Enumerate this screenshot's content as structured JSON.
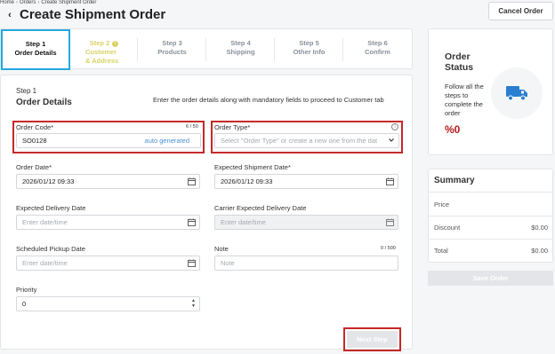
{
  "breadcrumb": [
    "Home",
    "Orders",
    "Create Shipment Order"
  ],
  "page_title": "Create Shipment Order",
  "cancel_label": "Cancel Order",
  "steps": [
    {
      "n": "Step 1",
      "label": "Order Details",
      "state": "active"
    },
    {
      "n": "Step 2",
      "label": "Customer & Address",
      "state": "warning"
    },
    {
      "n": "Step 3",
      "label": "Products",
      "state": "pending"
    },
    {
      "n": "Step 4",
      "label": "Shipping",
      "state": "pending"
    },
    {
      "n": "Step 5",
      "label": "Other Info",
      "state": "pending"
    },
    {
      "n": "Step 6",
      "label": "Confirm",
      "state": "pending"
    }
  ],
  "section": {
    "step": "Step 1",
    "title": "Order Details",
    "note": "Enter the order details along with mandatory fields to proceed to Customer tab"
  },
  "fields": {
    "order_code": {
      "label": "Order Code*",
      "counter": "6 / 50",
      "value": "SO0128",
      "hint": "auto generated"
    },
    "order_type": {
      "label": "Order Type*",
      "placeholder": "Select \"Order Type\" or create a new one from the dat"
    },
    "order_date": {
      "label": "Order Date*",
      "value": "2026/01/12 09:33"
    },
    "expected_shipment_date": {
      "label": "Expected Shipment Date*",
      "value": "2026/01/12 09:33"
    },
    "expected_delivery_date": {
      "label": "Expected Delivery Date",
      "placeholder": "Enter date/time"
    },
    "carrier_expected_delivery_date": {
      "label": "Carrier Expected Delivery Date",
      "placeholder": "Enter date/time"
    },
    "scheduled_pickup_date": {
      "label": "Scheduled Pickup Date",
      "placeholder": "Enter date/time"
    },
    "note": {
      "label": "Note",
      "counter": "0 / 500",
      "placeholder": "Note"
    },
    "priority": {
      "label": "Priority",
      "value": "0"
    }
  },
  "next_label": "Next Step",
  "order_status": {
    "title": "Order Status",
    "subtitle": "Follow all the steps to complete the order",
    "percent": "%0"
  },
  "summary": {
    "title": "Summary",
    "rows": [
      {
        "label": "Price",
        "value": ""
      },
      {
        "label": "Discount",
        "value": "$0.00"
      },
      {
        "label": "Total",
        "value": "$0.00"
      }
    ]
  },
  "save_label": "Save Order",
  "colors": {
    "accent": "#25a9e0",
    "warning": "#d9d264",
    "error": "#c62828",
    "brand_icon": "#2b7fd0"
  }
}
